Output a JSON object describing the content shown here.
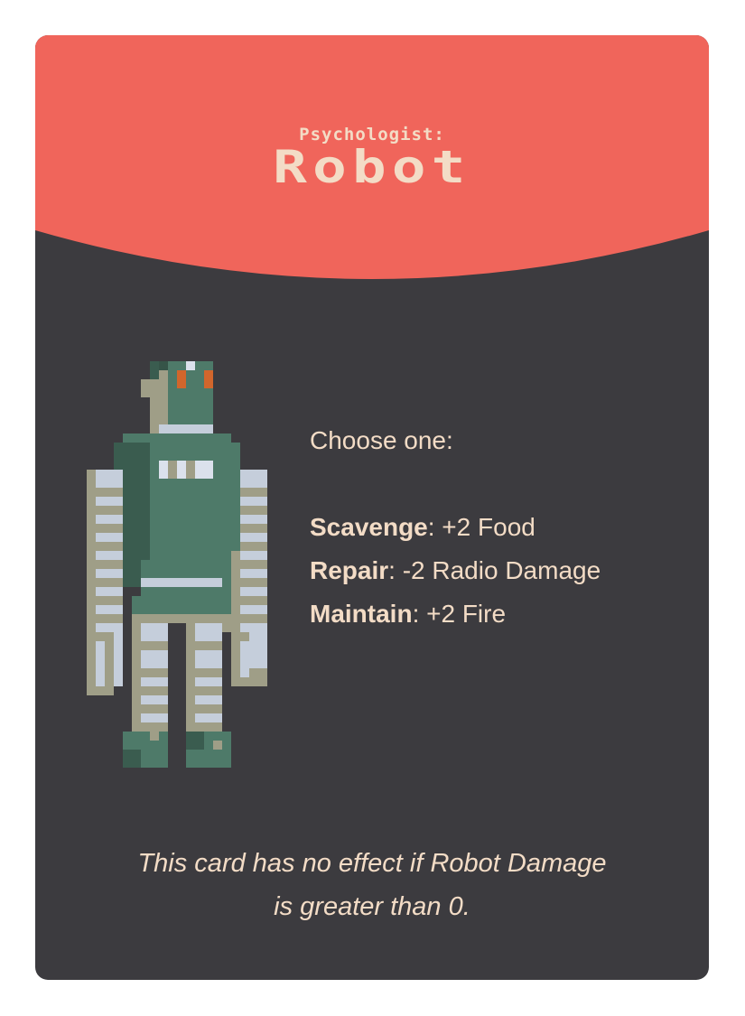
{
  "card": {
    "subtitle": "Psychologist:",
    "title": "Robot",
    "colors": {
      "header": "#f0655b",
      "body": "#3c3b3f",
      "text": "#f3dcc6"
    }
  },
  "effects": {
    "prompt": "Choose one:",
    "options": [
      {
        "name": "Scavenge",
        "effect": ": +2 Food"
      },
      {
        "name": "Repair",
        "effect": ": -2 Radio Damage"
      },
      {
        "name": "Maintain",
        "effect": ": +2 Fire"
      }
    ]
  },
  "footer": {
    "line1": "This card has no effect if Robot Damage",
    "line2": "is greater than 0."
  },
  "illustration": {
    "icon": "robot-pixel-art-icon"
  }
}
